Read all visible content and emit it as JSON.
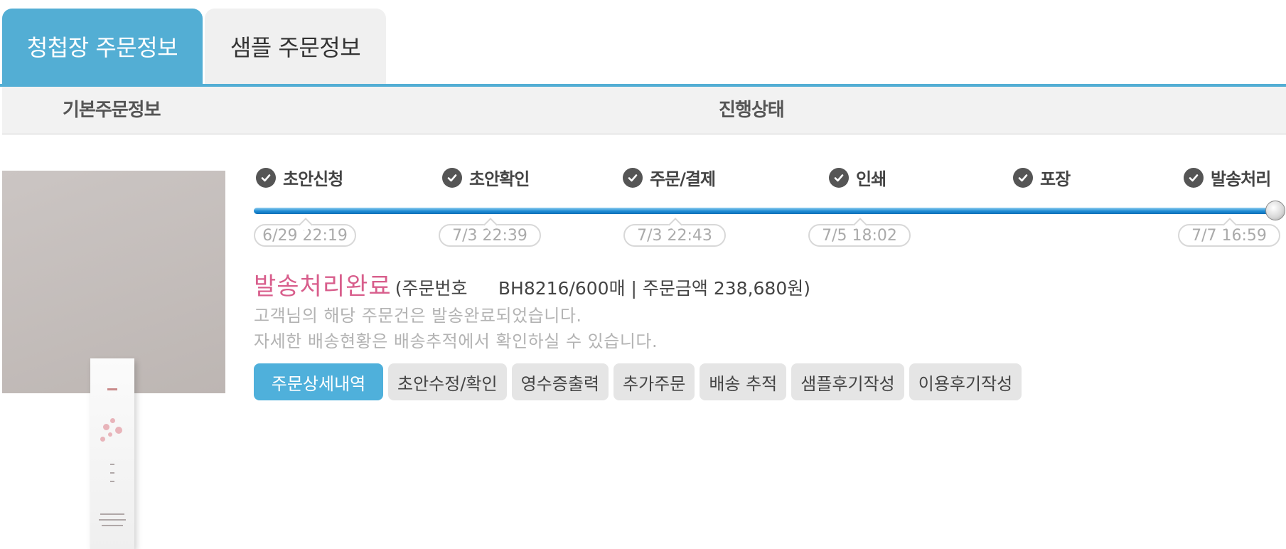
{
  "tabs": [
    {
      "label": "청첩장 주문정보",
      "active": true
    },
    {
      "label": "샘플 주문정보",
      "active": false
    }
  ],
  "header": {
    "basic_label": "기본주문정보",
    "progress_label": "진행상태"
  },
  "steps": [
    {
      "label": "초안신청",
      "date": "6/29 22:19"
    },
    {
      "label": "초안확인",
      "date": "7/3 22:39"
    },
    {
      "label": "주문/결제",
      "date": "7/3 22:43"
    },
    {
      "label": "인쇄",
      "date": "7/5 18:02"
    },
    {
      "label": "포장",
      "date": ""
    },
    {
      "label": "발송처리",
      "date": "7/7 16:59"
    }
  ],
  "progress": 1.0,
  "order": {
    "status_title": "발송처리완료",
    "order_no_label": "(주문번호",
    "order_detail": "BH8216/600매 | 주문금액 238,680원)",
    "message1": "고객님의 해당 주문건은 발송완료되었습니다.",
    "message2": "자세한 배송현황은 배송추적에서 확인하실 수 있습니다."
  },
  "buttons": [
    {
      "label": "주문상세내역",
      "primary": true
    },
    {
      "label": "초안수정/확인",
      "primary": false
    },
    {
      "label": "영수증출력",
      "primary": false
    },
    {
      "label": "추가주문",
      "primary": false
    },
    {
      "label": "배송 추적",
      "primary": false
    },
    {
      "label": "샘플후기작성",
      "primary": false
    },
    {
      "label": "이용후기작성",
      "primary": false
    }
  ],
  "colors": {
    "accent": "#53aed4",
    "status_pink": "#d85e8c",
    "check_dark": "#555555",
    "muted_text": "#b3b3b3"
  },
  "icons": {
    "step_check": "check-circle-icon",
    "progress_knob": "progress-knob-icon"
  }
}
